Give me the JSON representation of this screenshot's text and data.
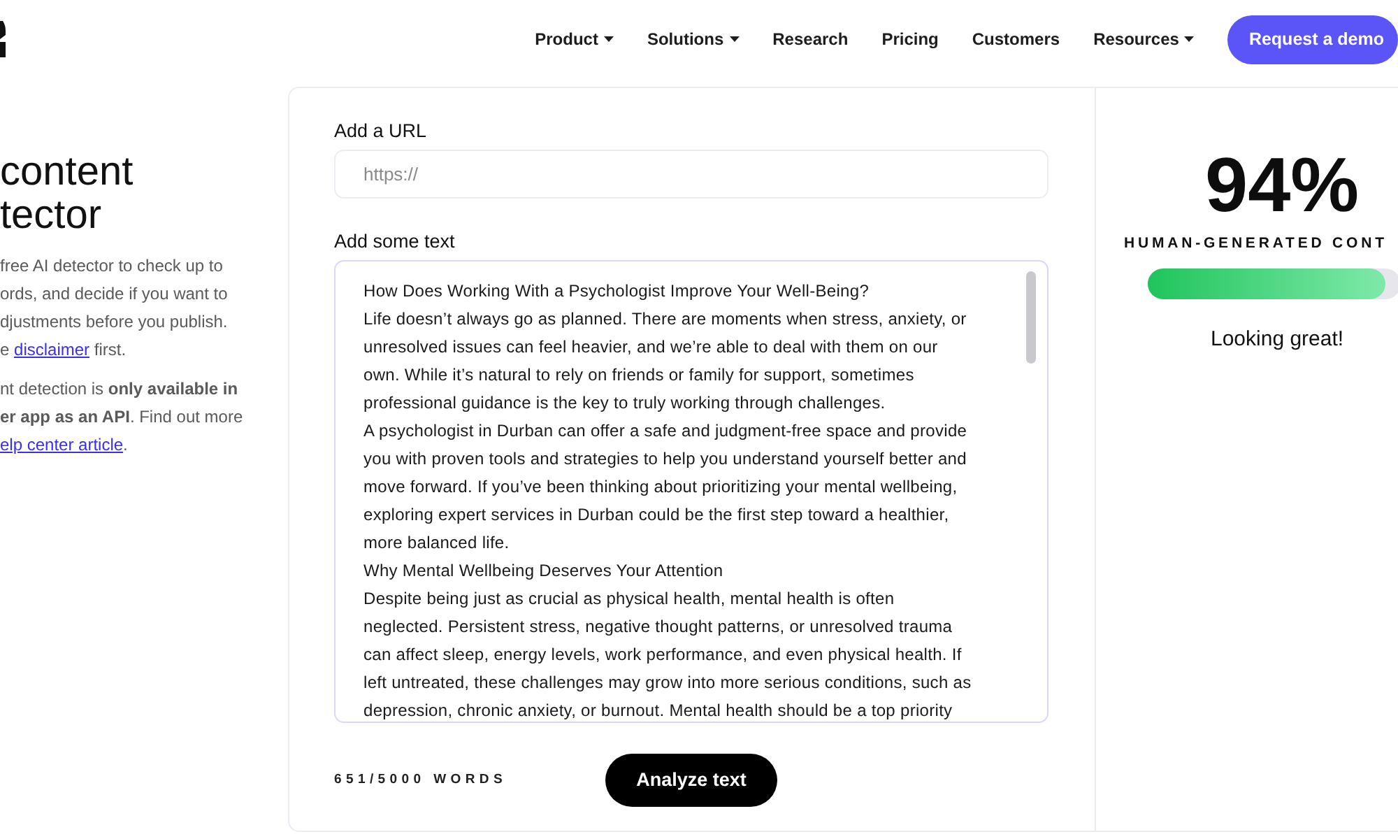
{
  "nav": {
    "items": [
      {
        "label": "Product",
        "dropdown": true
      },
      {
        "label": "Solutions",
        "dropdown": true
      },
      {
        "label": "Research",
        "dropdown": false
      },
      {
        "label": "Pricing",
        "dropdown": false
      },
      {
        "label": "Customers",
        "dropdown": false
      },
      {
        "label": "Resources",
        "dropdown": true
      }
    ],
    "cta": "Request a demo"
  },
  "intro": {
    "heading_lines": [
      "content",
      "tector"
    ],
    "paragraphs": [
      [
        [
          {
            "kind": "text",
            "text": "free AI detector to check up to"
          }
        ],
        [
          {
            "kind": "text",
            "text": "ords, and decide if you want to"
          }
        ],
        [
          {
            "kind": "text",
            "text": "djustments before you publish."
          }
        ],
        [
          {
            "kind": "text",
            "text": "e "
          },
          {
            "kind": "link",
            "text": "disclaimer"
          },
          {
            "kind": "text",
            "text": " first."
          }
        ]
      ],
      [
        [
          {
            "kind": "text",
            "text": "nt detection is **only available in**"
          }
        ],
        [
          {
            "kind": "text",
            "text": "**er app as an API**. Find out more"
          }
        ],
        [
          {
            "kind": "link",
            "text": "elp center article"
          },
          {
            "kind": "text",
            "text": "."
          }
        ]
      ]
    ]
  },
  "form": {
    "url": {
      "label": "Add a URL",
      "placeholder": "https://"
    },
    "text": {
      "label": "Add some text",
      "paragraphs": [
        "How Does Working With a Psychologist Improve Your Well-Being?",
        "Life doesn’t always go as planned. There are moments when stress, anxiety, or unresolved issues can feel heavier, and we’re able to deal with them on our own. While it’s natural to rely on friends or family for support, sometimes professional guidance is the key to truly working through challenges.",
        "A psychologist in Durban can offer a safe and judgment-free space and provide you with proven tools and strategies to help you understand yourself better and move forward. If you’ve been thinking about prioritizing your mental wellbeing, exploring expert services in Durban could be the first step toward a healthier, more balanced life.",
        "Why Mental Wellbeing Deserves Your Attention",
        "Despite being just as crucial as physical health, mental health is often neglected. Persistent stress, negative thought patterns, or unresolved trauma can affect sleep, energy levels, work performance, and even physical health. If left untreated, these challenges may grow into more serious conditions, such as depression, chronic anxiety, or burnout. Mental health should be a top priority"
      ]
    },
    "word_count": "651/5000 WORDS",
    "analyze_button": "Analyze text"
  },
  "result": {
    "score": "94%",
    "caption": "HUMAN-GENERATED CONT",
    "level": 0.94,
    "verdict": "Looking great!"
  }
}
